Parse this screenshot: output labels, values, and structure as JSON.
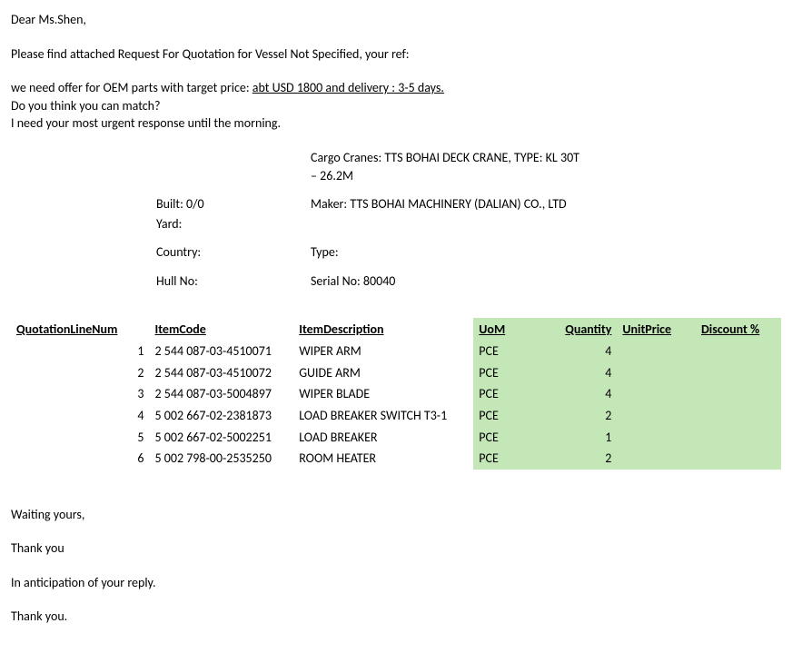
{
  "greeting": "Dear Ms.Shen,",
  "intro": "Please find attached Request For Quotation for Vessel Not Specified, your ref:",
  "body": {
    "line1_pre": "we need offer for OEM parts with target price: ",
    "line1_underlined": "abt USD 1800 and delivery : 3-5 days.",
    "line2": "Do you think you can match?",
    "line3": "I need your most urgent response until the morning."
  },
  "spec": {
    "cargo_cranes": "Cargo Cranes: TTS BOHAI DECK CRANE, TYPE: KL 30T – 26.2M",
    "built_label": "Built: 0/0",
    "maker": "Maker: TTS BOHAI MACHINERY (DALIAN) CO., LTD",
    "yard_label": "Yard:",
    "country_label": "Country:",
    "type_label": "Type:",
    "hull_label": "Hull No:",
    "serial": "Serial No: 80040"
  },
  "headers": {
    "line_num": "QuotationLineNum",
    "item_code": "ItemCode",
    "item_desc": "ItemDescription",
    "uom": "UoM",
    "qty": "Quantity",
    "unit_price": "UnitPrice",
    "discount": "Discount %"
  },
  "rows": [
    {
      "n": "1",
      "code": "2 544 087-03-4510071",
      "desc": "WIPER ARM",
      "uom": "PCE",
      "qty": "4"
    },
    {
      "n": "2",
      "code": "2 544 087-03-4510072",
      "desc": "GUIDE ARM",
      "uom": "PCE",
      "qty": "4"
    },
    {
      "n": "3",
      "code": "2 544 087-03-5004897",
      "desc": "WIPER BLADE",
      "uom": "PCE",
      "qty": "4"
    },
    {
      "n": "4",
      "code": "5 002 667-02-2381873",
      "desc": "LOAD BREAKER SWITCH T3-1",
      "uom": "PCE",
      "qty": "2"
    },
    {
      "n": "5",
      "code": "5 002 667-02-5002251",
      "desc": "LOAD BREAKER",
      "uom": "PCE",
      "qty": "1"
    },
    {
      "n": "6",
      "code": "5 002 798-00-2535250",
      "desc": "ROOM HEATER",
      "uom": "PCE",
      "qty": "2"
    }
  ],
  "closing": {
    "l1": "Waiting yours,",
    "l2": "Thank you",
    "l3": "In anticipation of your reply.",
    "l4": "Thank you."
  }
}
